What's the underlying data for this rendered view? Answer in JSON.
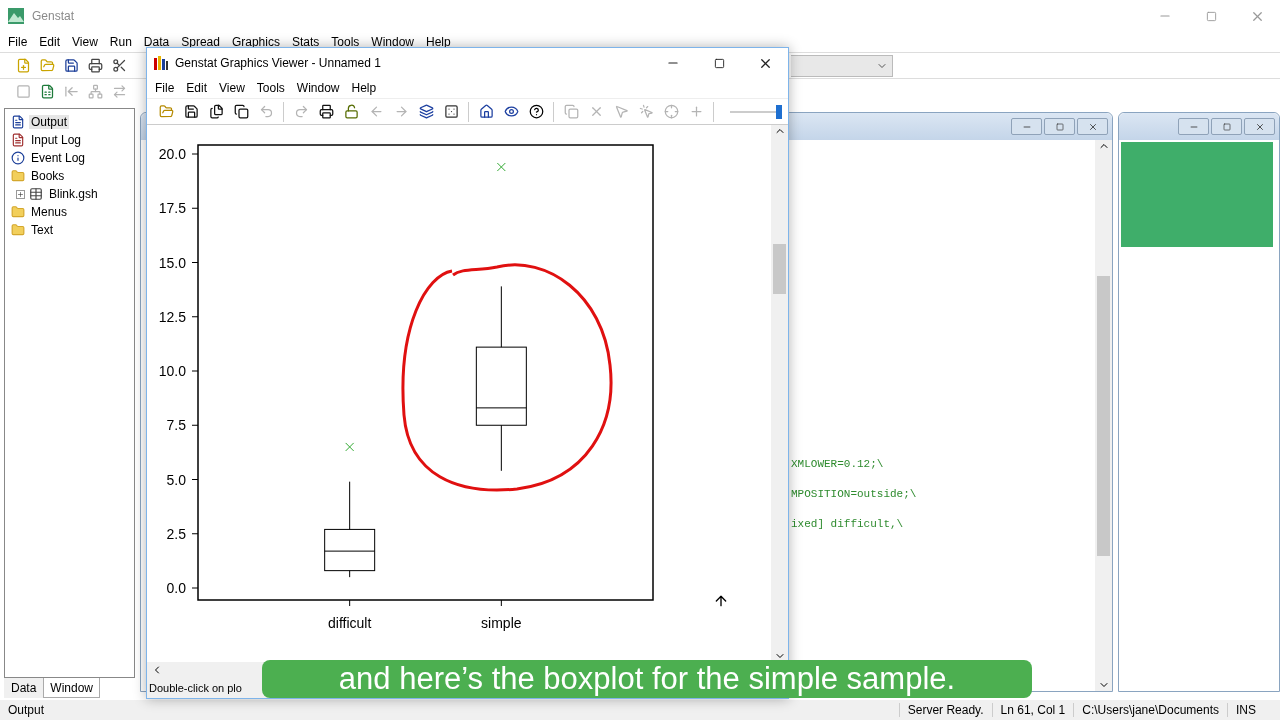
{
  "app": {
    "title": "Genstat",
    "menu": [
      "File",
      "Edit",
      "View",
      "Run",
      "Data",
      "Spread",
      "Graphics",
      "Stats",
      "Tools",
      "Window",
      "Help"
    ],
    "toolbar_1": [
      {
        "disabled": false
      },
      {
        "disabled": false
      },
      {
        "disabled": false
      },
      {
        "disabled": false
      },
      {
        "disabled": false
      }
    ],
    "toolbar_2": [
      {
        "disabled": true
      },
      {
        "disabled": false
      },
      {
        "disabled": true
      },
      {
        "disabled": true
      },
      {
        "disabled": true
      }
    ]
  },
  "sidebar": {
    "items": [
      {
        "label": "Output",
        "kind": "document",
        "selected": true
      },
      {
        "label": "Input Log",
        "kind": "log",
        "selected": false
      },
      {
        "label": "Event Log",
        "kind": "event",
        "selected": false
      },
      {
        "label": "Books",
        "kind": "folder",
        "selected": false,
        "children": [
          {
            "label": "Blink.gsh",
            "kind": "sheet",
            "selected": false,
            "expanded": false
          }
        ]
      },
      {
        "label": "Menus",
        "kind": "folder",
        "selected": false
      },
      {
        "label": "Text",
        "kind": "folder",
        "selected": false
      }
    ],
    "tabs": [
      {
        "label": "Data",
        "selected": false
      },
      {
        "label": "Window",
        "selected": true
      }
    ]
  },
  "output_window": {
    "code_lines": [
      "XMLOWER=0.12;\\",
      "MPOSITION=outside;\\",
      "ixed] difficult,\\"
    ]
  },
  "viewer": {
    "title": "Genstat Graphics Viewer - Unnamed 1",
    "menu": [
      "File",
      "Edit",
      "View",
      "Tools",
      "Window",
      "Help"
    ],
    "toolbar": [
      {
        "disabled": false
      },
      {
        "disabled": false
      },
      {
        "disabled": false
      },
      {
        "disabled": false
      },
      {
        "disabled": true
      },
      {
        "disabled": true
      },
      {
        "disabled": false
      },
      {
        "disabled": false
      },
      {
        "disabled": true
      },
      {
        "disabled": true
      },
      {
        "disabled": false
      },
      {
        "disabled": false
      },
      {
        "disabled": false
      },
      {
        "disabled": false
      },
      {
        "disabled": false
      },
      {
        "disabled": true
      },
      {
        "disabled": true
      },
      {
        "disabled": true
      },
      {
        "disabled": true
      },
      {
        "disabled": true
      },
      {
        "disabled": true
      }
    ],
    "zoom": {
      "level": 0.95
    },
    "status": "Double-click on plo",
    "plot": {
      "y_ticks": [
        "20.0",
        "17.5",
        "15.0",
        "12.5",
        "10.0",
        "7.5",
        "5.0",
        "2.5",
        "0.0"
      ],
      "categories": [
        "difficult",
        "simple"
      ]
    }
  },
  "status_bar": {
    "panel": "Output",
    "items": [
      "Server Ready.",
      "Ln 61, Col 1",
      "C:\\Users\\jane\\Documents",
      "INS"
    ]
  },
  "caption": "and here’s the boxplot for the simple sample."
}
